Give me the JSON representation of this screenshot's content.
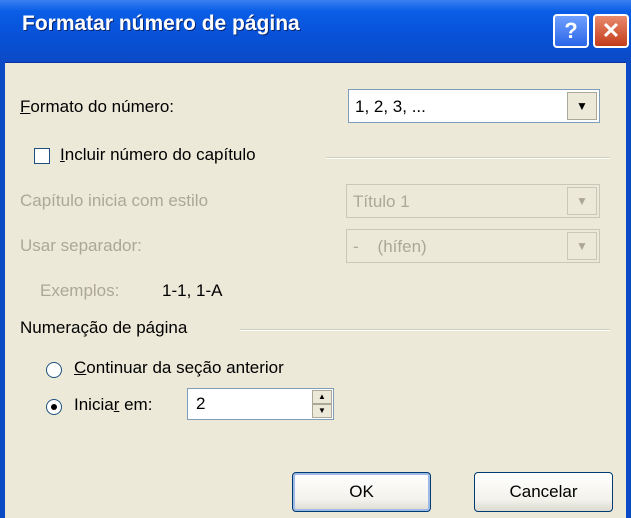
{
  "dialog": {
    "title": "Formatar número de página",
    "help_glyph": "?",
    "close_glyph": "✕"
  },
  "number_format": {
    "label_mnemonic": "F",
    "label_rest": "ormato do número:",
    "value": "1, 2, 3, ..."
  },
  "chapter": {
    "checkbox_label_mnemonic": "I",
    "checkbox_label_rest": "ncluir número do capítulo",
    "checked": false,
    "starts_with_style_label": "Capítulo inicia com estilo",
    "starts_with_style_value": "Título 1",
    "separator_label": "Usar separador:",
    "separator_value": "-    (hífen)",
    "examples_label": "Exemplos:",
    "examples_value": "1-1, 1-A"
  },
  "page_numbering": {
    "group_label": "Numeração de página",
    "continue_mnemonic": "C",
    "continue_rest": "ontinuar da seção anterior",
    "start_at_pre": "Inicia",
    "start_at_mnemonic": "r",
    "start_at_post": " em:",
    "start_at_value": "2",
    "selected": "start_at"
  },
  "buttons": {
    "ok": "OK",
    "cancel": "Cancelar"
  },
  "colors": {
    "titlebar": "#0a5ee6",
    "dialog_bg": "#ece9d8",
    "disabled_text": "#aca899"
  }
}
